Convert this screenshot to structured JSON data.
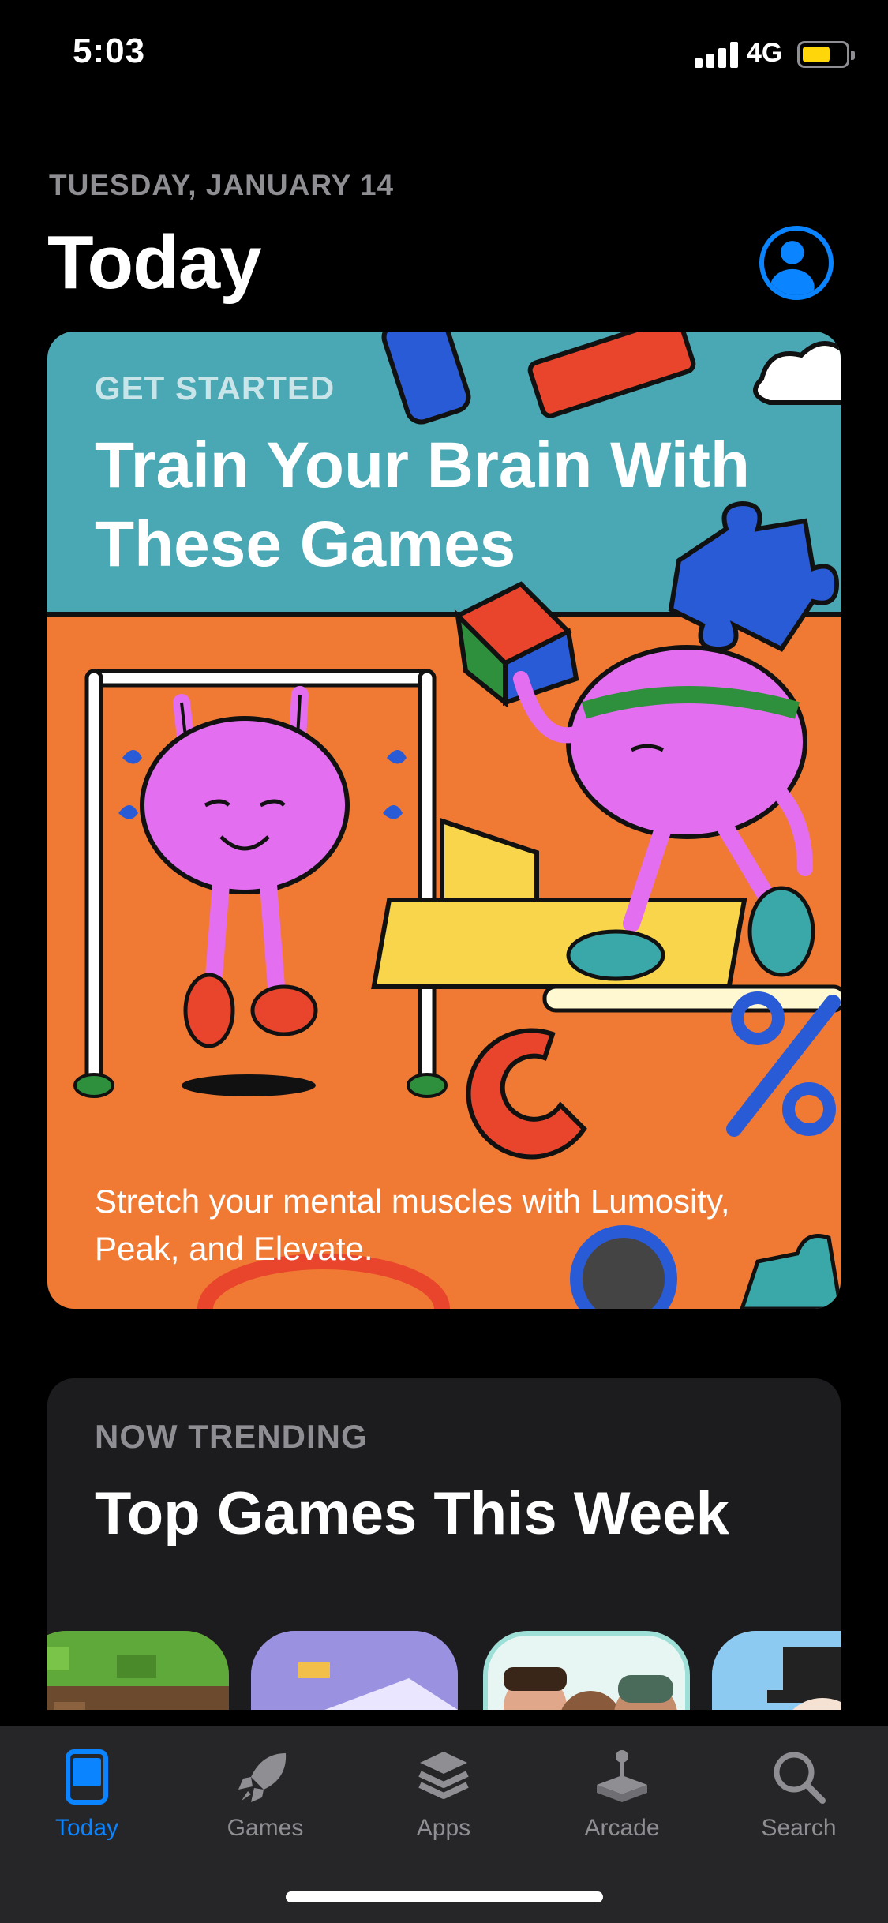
{
  "status_bar": {
    "time": "5:03",
    "network": "4G"
  },
  "header": {
    "date": "TUESDAY, JANUARY 14",
    "title": "Today"
  },
  "feature_card": {
    "eyebrow": "GET STARTED",
    "title": "Train Your Brain With These Games",
    "description": "Stretch your mental muscles with Lumosity, Peak, and Elevate."
  },
  "trending_card": {
    "eyebrow": "NOW TRENDING",
    "title": "Top Games This Week"
  },
  "tab_bar": {
    "tabs": [
      {
        "label": "Today",
        "icon": "today-icon",
        "active": true
      },
      {
        "label": "Games",
        "icon": "rocket-icon",
        "active": false
      },
      {
        "label": "Apps",
        "icon": "layers-icon",
        "active": false
      },
      {
        "label": "Arcade",
        "icon": "joystick-icon",
        "active": false
      },
      {
        "label": "Search",
        "icon": "search-icon",
        "active": false
      }
    ]
  },
  "colors": {
    "accent": "#0a84ff",
    "card_top": "#4aa8b4",
    "card_bottom": "#f07a33",
    "battery": "#ffd60a"
  }
}
